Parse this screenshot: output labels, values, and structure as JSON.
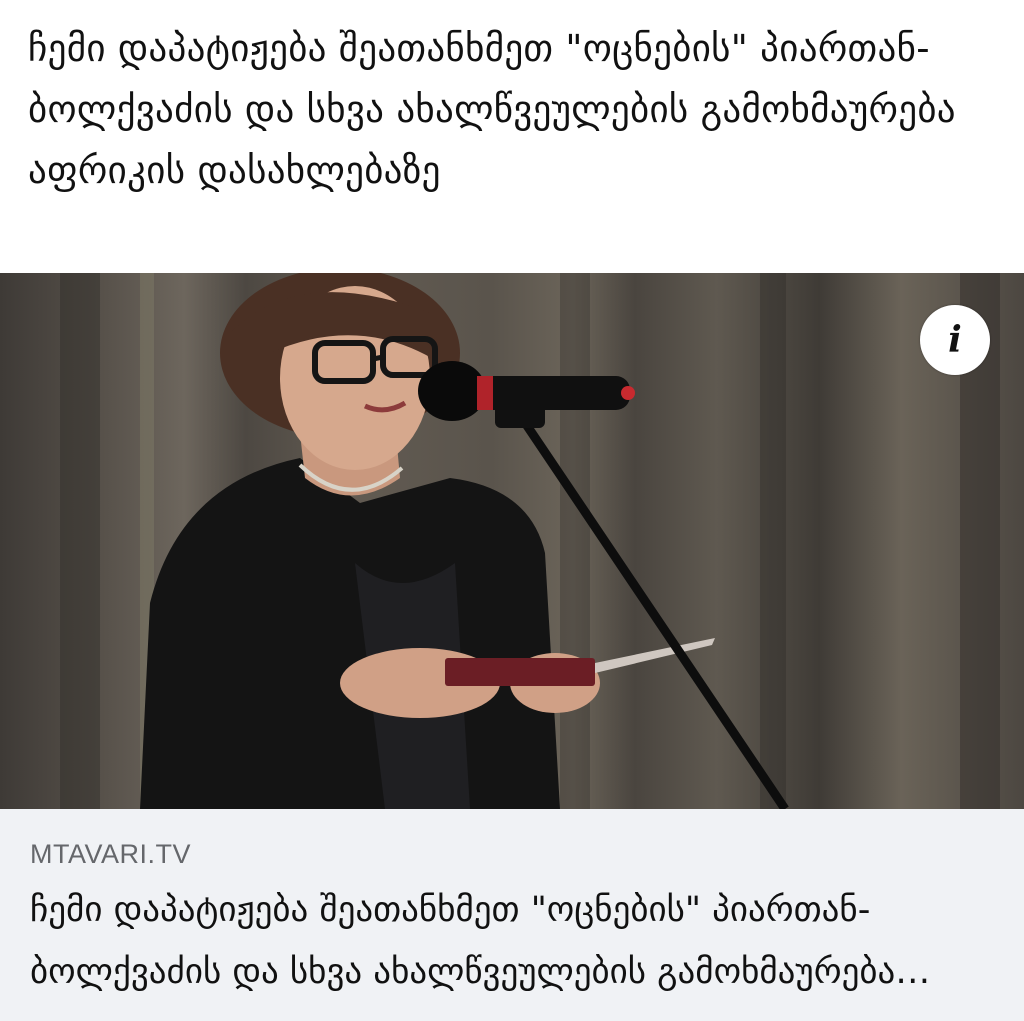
{
  "post": {
    "text": "ჩემი დაპატიჟება შეათანხმეთ \"ოცნების\" პიართან-ბოლქვაძის და სხვა ახალწვეულების გამოხმაურება აფრიკის დასახლებაზე"
  },
  "link_preview": {
    "info_label": "i",
    "domain": "MTAVARI.TV",
    "headline": "ჩემი დაპატიჟება შეათანხმეთ \"ოცნების\" პიართან-ბოლქვაძის და სხვა ახალწვეულების გამოხმაურება აფრიკის დასახლებაზე"
  },
  "icons": {
    "info": "info-icon"
  }
}
